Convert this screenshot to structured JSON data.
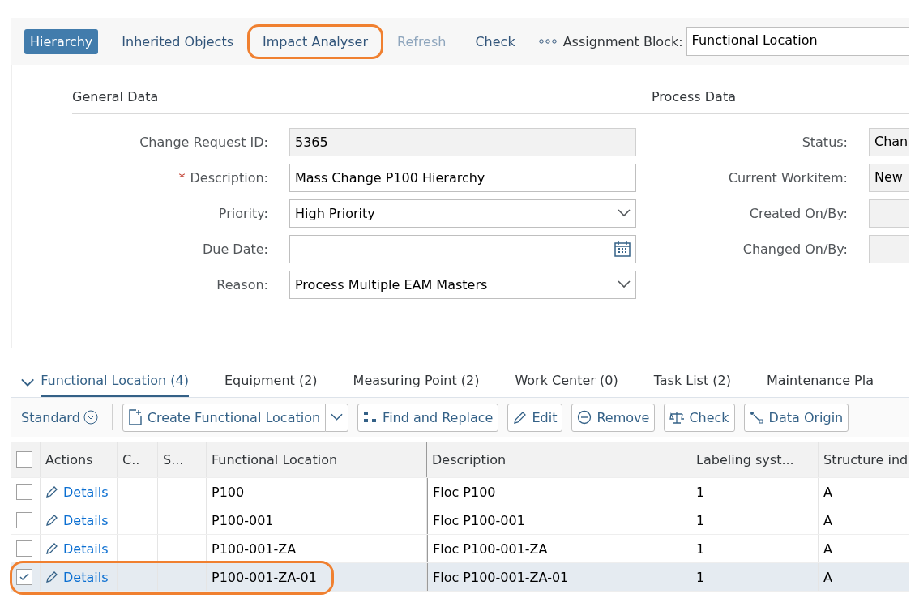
{
  "toolbar": {
    "buttons": [
      {
        "label": "Hierarchy",
        "selected": true,
        "disabled": false,
        "circled": false
      },
      {
        "label": "Inherited Objects",
        "selected": false,
        "disabled": false,
        "circled": false
      },
      {
        "label": "Impact Analyser",
        "selected": false,
        "disabled": false,
        "circled": true
      },
      {
        "label": "Refresh",
        "selected": false,
        "disabled": true,
        "circled": false
      },
      {
        "label": "Check",
        "selected": false,
        "disabled": false,
        "circled": false
      }
    ],
    "assignment_block": {
      "label": "Assignment Block:",
      "value": "Functional Location"
    }
  },
  "general_data": {
    "title": "General Data",
    "fields": [
      {
        "label": "Change Request ID:",
        "value": "5365",
        "kind": "readonly"
      },
      {
        "label": "Description:",
        "value": "Mass Change P100 Hierarchy",
        "kind": "input",
        "required_mark": "*"
      },
      {
        "label": "Priority:",
        "value": "High Priority",
        "kind": "select"
      },
      {
        "label": "Due Date:",
        "kind": "date"
      },
      {
        "label": "Reason:",
        "value": "Process Multiple EAM Masters",
        "kind": "select"
      }
    ]
  },
  "process_data": {
    "title": "Process Data",
    "fields": [
      {
        "label": "Status:",
        "value": "Chan"
      },
      {
        "label": "Current Workitem:",
        "value": "New"
      },
      {
        "label": "Created On/By:"
      },
      {
        "label": "Changed On/By:"
      }
    ]
  },
  "tabs": [
    {
      "label": "Functional Location (4)",
      "selected": true
    },
    {
      "label": "Equipment (2)",
      "selected": false
    },
    {
      "label": "Measuring Point (2)",
      "selected": false
    },
    {
      "label": "Work Center (0)",
      "selected": false
    },
    {
      "label": "Task List (2)",
      "selected": false
    },
    {
      "label": "Maintenance Pla",
      "selected": false
    }
  ],
  "table_toolbar": {
    "variant": "Standard",
    "buttons": [
      {
        "label": "Create Functional Location",
        "kind": "create"
      },
      {
        "label": "Find and Replace",
        "kind": "find"
      },
      {
        "label": "Edit",
        "kind": "edit"
      },
      {
        "label": "Remove",
        "kind": "remove"
      },
      {
        "label": "Check",
        "kind": "check"
      },
      {
        "label": "Data Origin",
        "kind": "origin"
      }
    ]
  },
  "table": {
    "all_selected": false,
    "columns": [
      "Actions",
      "C..",
      "S...",
      "Functional Location",
      "Description",
      "Labeling syst...",
      "Structure ind"
    ],
    "rows": [
      {
        "selected": false,
        "circled": false,
        "action": "Details",
        "functional_location": "P100",
        "description": "Floc P100",
        "labeling": "1",
        "structure": "A"
      },
      {
        "selected": false,
        "circled": false,
        "action": "Details",
        "functional_location": "P100-001",
        "description": "Floc P100-001",
        "labeling": "1",
        "structure": "A"
      },
      {
        "selected": false,
        "circled": false,
        "action": "Details",
        "functional_location": "P100-001-ZA",
        "description": "Floc P100-001-ZA",
        "labeling": "1",
        "structure": "A"
      },
      {
        "selected": true,
        "circled": true,
        "action": "Details",
        "functional_location": "P100-001-ZA-01",
        "description": "Floc P100-001-ZA-01",
        "labeling": "1",
        "structure": "A"
      }
    ]
  }
}
